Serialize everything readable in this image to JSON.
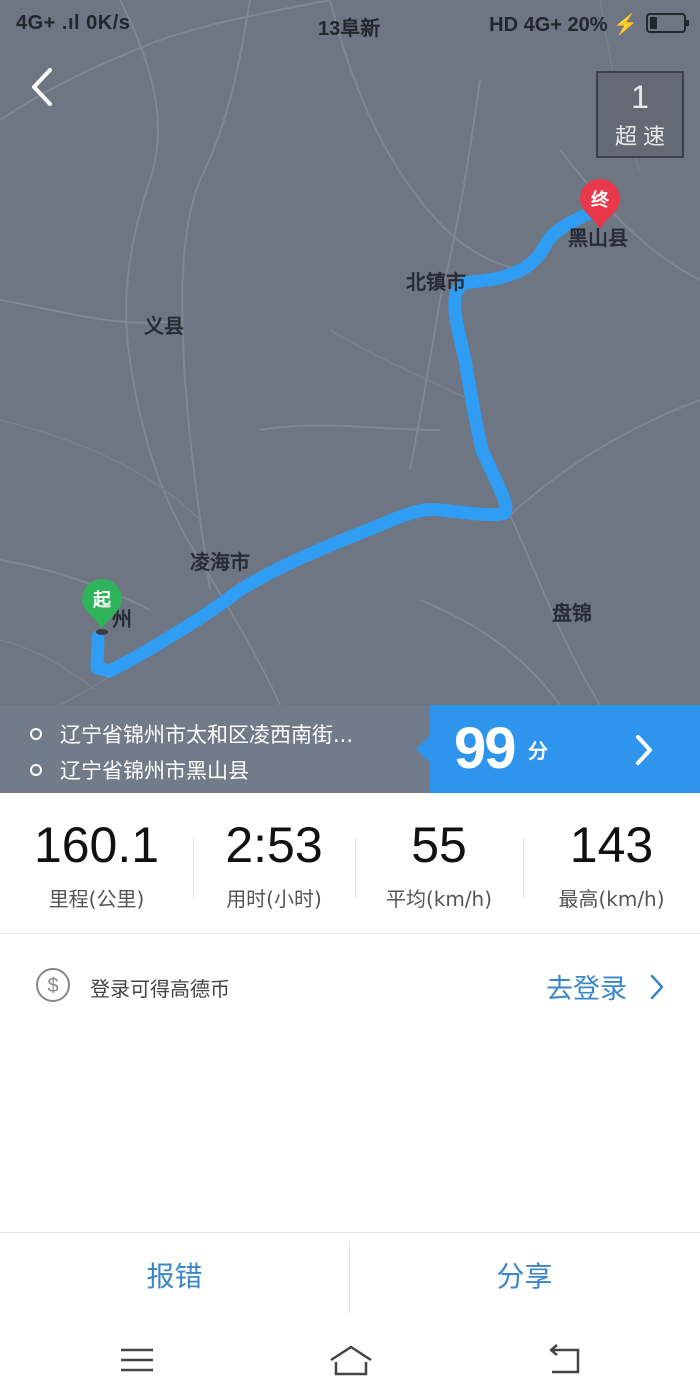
{
  "status_bar": {
    "left": "4G+ .ıl 0K/s",
    "center": "13阜新",
    "right": "HD 4G+ 20% ⚡"
  },
  "map": {
    "speeding": {
      "count": "1",
      "label": "超速"
    },
    "cities": {
      "heishan": "黑山县",
      "beizhen": "北镇市",
      "yixian": "义县",
      "linghai": "凌海市",
      "jinzhou": "州",
      "panjin": "盘锦"
    },
    "start_marker": "起",
    "end_marker": "终",
    "route_color": "#2f9df4"
  },
  "route": {
    "origin": "辽宁省锦州市太和区凌西南街...",
    "destination": "辽宁省锦州市黑山县",
    "score": "99",
    "score_unit": "分"
  },
  "stats": [
    {
      "value": "160.1",
      "label": "里程(公里)"
    },
    {
      "value": "2:53",
      "label": "用时(小时)"
    },
    {
      "value": "55",
      "label": "平均(km/h)"
    },
    {
      "value": "143",
      "label": "最高(km/h)"
    }
  ],
  "login": {
    "text": "登录可得高德币",
    "link": "去登录"
  },
  "actions": {
    "report": "报错",
    "share": "分享"
  },
  "colors": {
    "accent": "#2f95ec",
    "link": "#3a86c9",
    "start_pin": "#2fb35a",
    "end_pin": "#e8384a"
  }
}
